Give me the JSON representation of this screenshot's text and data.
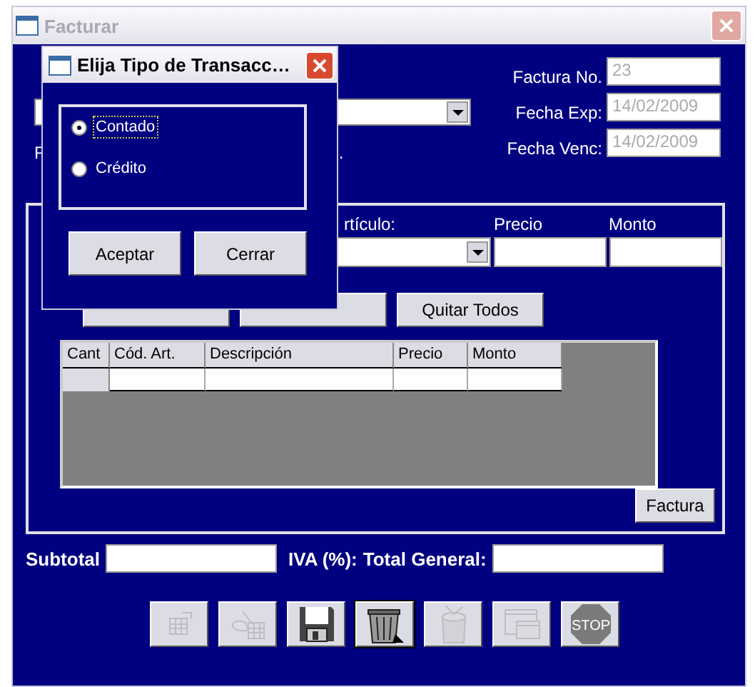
{
  "window": {
    "title": "Facturar"
  },
  "header": {
    "label_2": "F",
    "label_3": "."
  },
  "invoice": [
    {
      "label": "Factura No.",
      "value": "23",
      "disabled": true
    },
    {
      "label": "Fecha Exp:",
      "value": "14/02/2009",
      "disabled": true
    },
    {
      "label": "Fecha Venc:",
      "value": "14/02/2009",
      "disabled": true
    }
  ],
  "detail": {
    "article_label": "rtículo:",
    "price_label": "Precio",
    "amount_label": "Monto",
    "buttons": [
      "Quitar Todos"
    ],
    "table": {
      "columns": [
        "Cant",
        "Cód. Art.",
        "Descripción",
        "Precio",
        "Monto"
      ]
    },
    "invoice_button": "Factura"
  },
  "totals": {
    "subtotal_label": "Subtotal",
    "tax_label": "IVA (%):",
    "total_label": "Total General:"
  },
  "toolbar": [
    {
      "kind": "new",
      "disabled": true
    },
    {
      "kind": "edit",
      "disabled": true
    },
    {
      "kind": "save",
      "disabled": false
    },
    {
      "kind": "trash",
      "disabled": false
    },
    {
      "kind": "bin",
      "disabled": true
    },
    {
      "kind": "windows",
      "disabled": true
    },
    {
      "kind": "stop",
      "disabled": true,
      "label": "STOP"
    }
  ],
  "dialog": {
    "title": "Elija Tipo de Transacc…",
    "options": [
      {
        "label": "Contado",
        "selected": true,
        "focused": true
      },
      {
        "label": "Crédito",
        "selected": false,
        "focused": false
      }
    ],
    "buttons": [
      "Aceptar",
      "Cerrar"
    ]
  }
}
